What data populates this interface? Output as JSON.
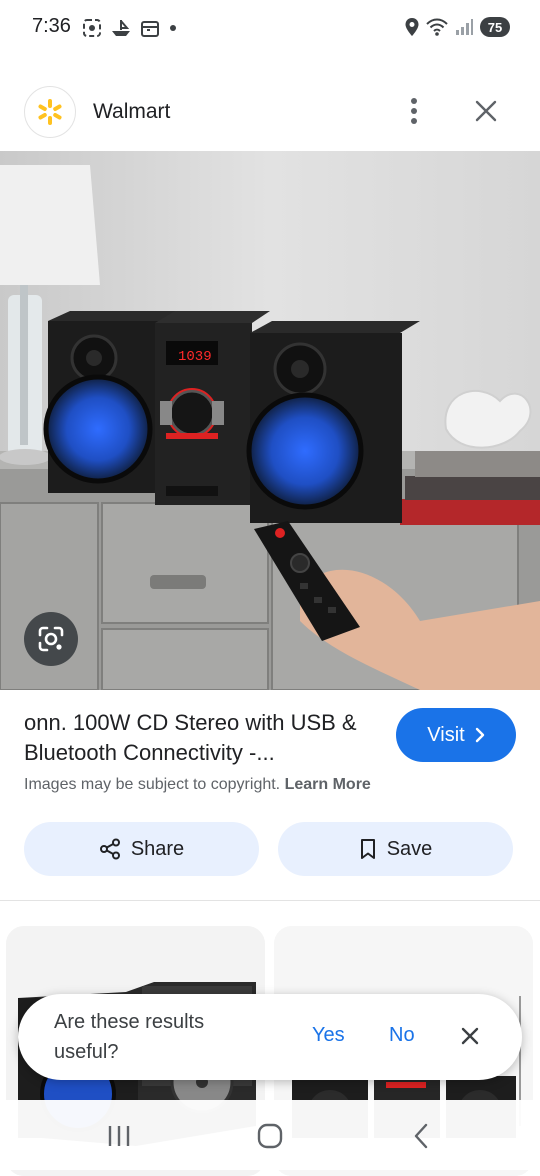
{
  "status_bar": {
    "time": "7:36",
    "battery": "75",
    "left_icons": [
      "screenshot-icon",
      "boat-icon",
      "calendar-icon",
      "dot-icon"
    ],
    "right_icons": [
      "location-icon",
      "wifi-icon",
      "signal-icon",
      "battery-icon"
    ]
  },
  "header": {
    "site_name": "Walmart",
    "brand_color": "#ffc220"
  },
  "result": {
    "title": "onn. 100W CD Stereo with USB & Bluetooth Connectivity -...",
    "visit_label": "Visit",
    "copyright_text": "Images may be subject to copyright.",
    "learn_more": "Learn More"
  },
  "actions": {
    "share_label": "Share",
    "save_label": "Save"
  },
  "feedback": {
    "question": "Are these results useful?",
    "yes_label": "Yes",
    "no_label": "No"
  },
  "colors": {
    "accent": "#1a73e8",
    "button_bg": "#e8f0fe"
  }
}
